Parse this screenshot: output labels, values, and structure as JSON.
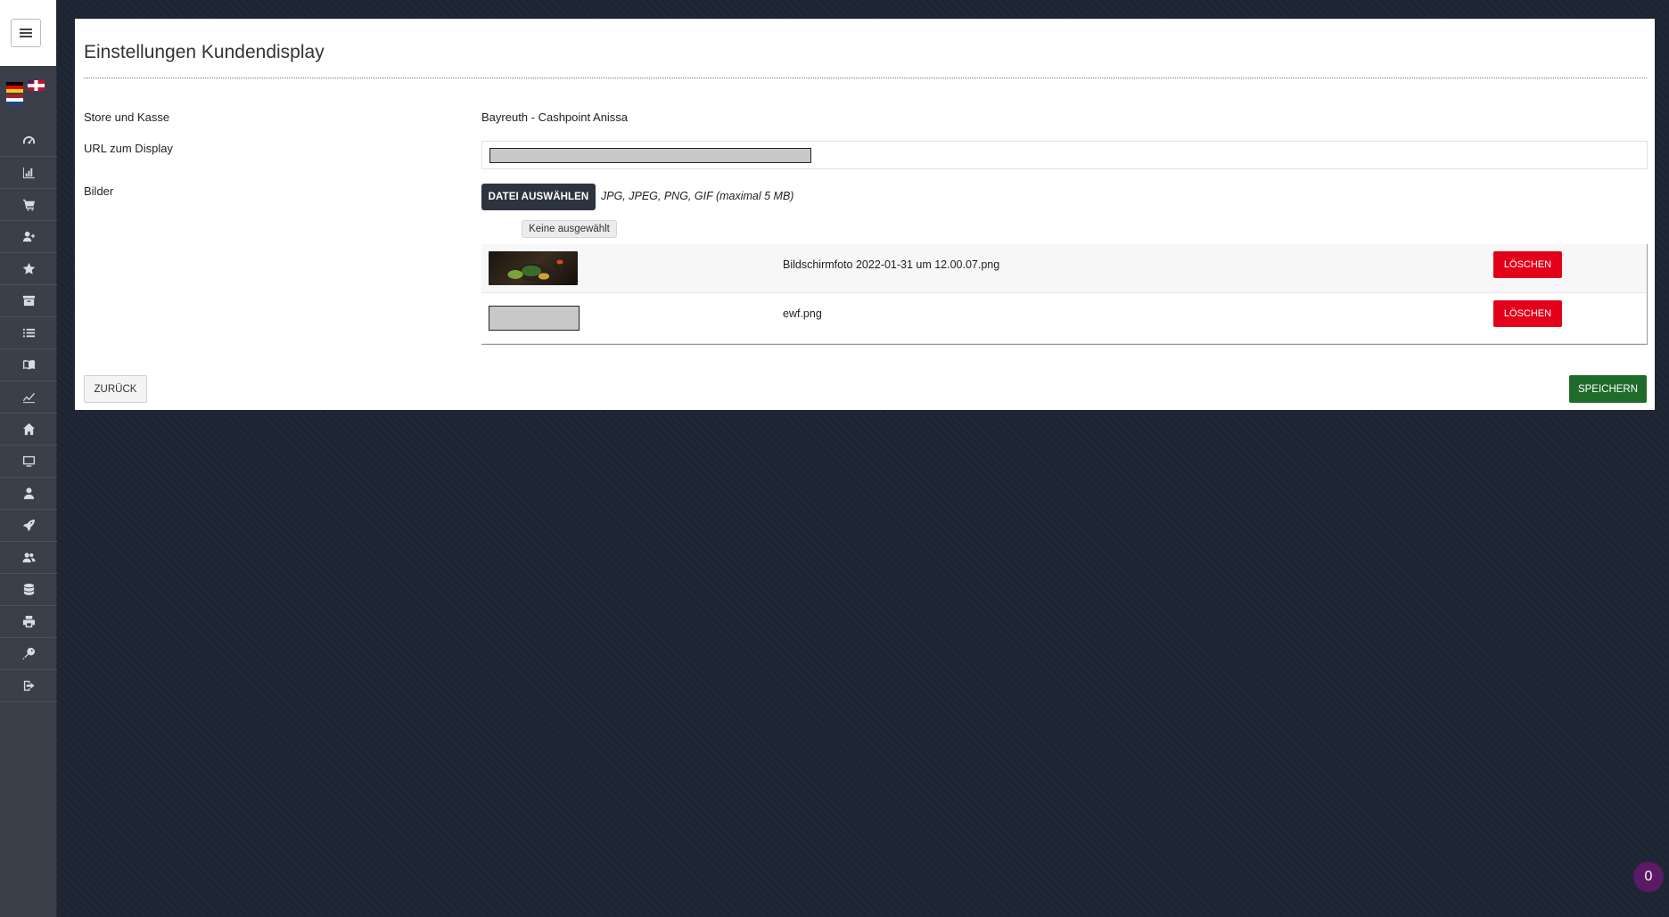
{
  "sidebar": {
    "menu_toggle_icon": "hamburger-icon",
    "flags": [
      "flag-de-icon",
      "flag-uk-icon",
      "flag-nl-icon"
    ],
    "nav_icons": [
      "dashboard-icon",
      "bar-chart-icon",
      "cart-icon",
      "add-user-icon",
      "star-icon",
      "archive-icon",
      "list-icon",
      "book-icon",
      "line-chart-icon",
      "home-icon",
      "monitor-icon",
      "user-icon",
      "rocket-icon",
      "users-icon",
      "database-icon",
      "printer-icon",
      "key-icon",
      "logout-icon"
    ]
  },
  "page": {
    "title": "Einstellungen Kundendisplay"
  },
  "form": {
    "store_label": "Store und Kasse",
    "store_value": "Bayreuth - Cashpoint Anissa",
    "url_label": "URL zum Display",
    "images_label": "Bilder",
    "file_button": "DATEI AUSWÄHLEN",
    "file_hint": "JPG, JPEG, PNG, GIF (maximal 5 MB)",
    "file_tooltip": "Keine ausgewählt"
  },
  "images": [
    {
      "filename": "Bildschirmfoto 2022-01-31 um 12.00.07.png",
      "delete_label": "LÖSCHEN"
    },
    {
      "filename": "ewf.png",
      "delete_label": "LÖSCHEN"
    }
  ],
  "actions": {
    "back_label": "ZURÜCK",
    "save_label": "SPEICHERN"
  },
  "counter": {
    "value": "0"
  },
  "colors": {
    "sidebar_bg": "#3a3f4a",
    "page_bg": "#1e2532",
    "primary_dark": "#2e3340",
    "danger": "#e3001b",
    "success": "#1f6b2a",
    "badge": "#5b1a66"
  }
}
